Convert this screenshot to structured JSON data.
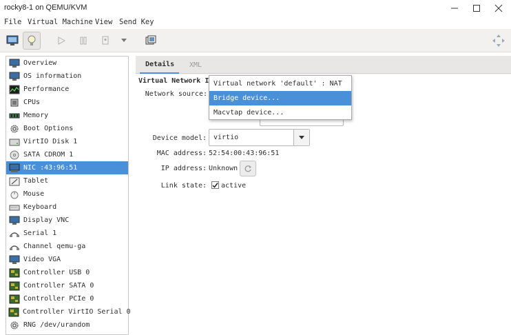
{
  "window": {
    "title": "rocky8-1 on QEMU/KVM"
  },
  "menu": [
    "File",
    "Virtual Machine",
    "View",
    "Send Key"
  ],
  "sidebar": {
    "items": [
      {
        "label": "Overview",
        "icon": "monitor-icon"
      },
      {
        "label": "OS information",
        "icon": "monitor-icon"
      },
      {
        "label": "Performance",
        "icon": "performance-icon"
      },
      {
        "label": "CPUs",
        "icon": "cpu-icon"
      },
      {
        "label": "Memory",
        "icon": "memory-icon"
      },
      {
        "label": "Boot Options",
        "icon": "gear-icon"
      },
      {
        "label": "VirtIO Disk 1",
        "icon": "disk-icon"
      },
      {
        "label": "SATA CDROM 1",
        "icon": "cdrom-icon"
      },
      {
        "label": "NIC :43:96:51",
        "icon": "nic-icon",
        "selected": true
      },
      {
        "label": "Tablet",
        "icon": "tablet-icon"
      },
      {
        "label": "Mouse",
        "icon": "mouse-icon"
      },
      {
        "label": "Keyboard",
        "icon": "keyboard-icon"
      },
      {
        "label": "Display VNC",
        "icon": "monitor-icon"
      },
      {
        "label": "Serial 1",
        "icon": "serial-icon"
      },
      {
        "label": "Channel qemu-ga",
        "icon": "serial-icon"
      },
      {
        "label": "Video VGA",
        "icon": "monitor-icon"
      },
      {
        "label": "Controller USB 0",
        "icon": "controller-icon"
      },
      {
        "label": "Controller SATA 0",
        "icon": "controller-icon"
      },
      {
        "label": "Controller PCIe 0",
        "icon": "controller-icon"
      },
      {
        "label": "Controller VirtIO Serial 0",
        "icon": "controller-icon"
      },
      {
        "label": "RNG /dev/urandom",
        "icon": "gear-icon"
      }
    ]
  },
  "tabs": {
    "details": "Details",
    "xml": "XML"
  },
  "nic": {
    "section_title": "Virtual Network In",
    "network_source_label": "Network source:",
    "device_model_label": "Device model:",
    "device_model_value": "virtio",
    "mac_label": "MAC address:",
    "mac_value": "52:54:00:43:96:51",
    "ip_label": "IP address:",
    "ip_value": "Unknown",
    "link_label": "Link state:",
    "link_value": "active",
    "link_checked": true
  },
  "network_source_dropdown": {
    "options": [
      "Virtual network 'default' : NAT",
      "Bridge device...",
      "Macvtap device..."
    ],
    "highlighted_index": 1
  },
  "colors": {
    "accent": "#4a90d9",
    "panel_bg": "#f2f1f0"
  }
}
